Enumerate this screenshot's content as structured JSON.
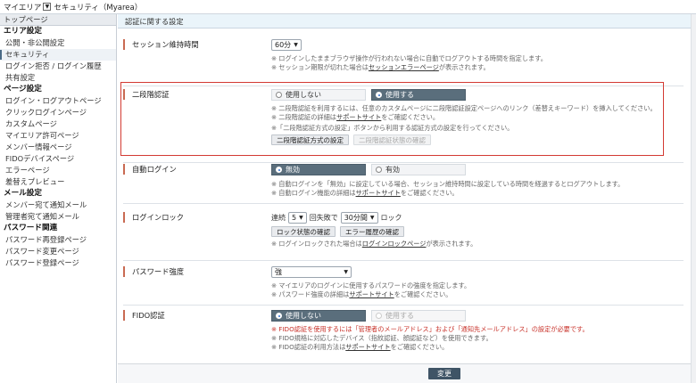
{
  "topbar": {
    "app": "マイエリア",
    "dropdown_glyph": "▼",
    "section": "セキュリティ（Myarea）"
  },
  "sidebar": {
    "top": "トップページ",
    "groups": [
      {
        "heading": "エリア設定",
        "items": [
          "公開・非公開設定",
          "セキュリティ",
          "ログイン拒否 / ログイン履歴",
          "共有設定"
        ]
      },
      {
        "heading": "ページ設定",
        "items": [
          "ログイン・ログアウトページ",
          "クリックログインページ",
          "カスタムページ",
          "マイエリア許可ページ",
          "メンバー情報ページ",
          "FIDOデバイスページ",
          "エラーページ",
          "差替えプレビュー"
        ]
      },
      {
        "heading": "メール設定",
        "items": [
          "メンバー宛て通知メール",
          "管理者宛て通知メール"
        ]
      },
      {
        "heading": "パスワード関連",
        "items": [
          "パスワード再登録ページ",
          "パスワード変更ページ",
          "パスワード登録ページ"
        ]
      }
    ]
  },
  "main": {
    "header": "認証に関する設定",
    "session": {
      "label": "セッション維持時間",
      "value": "60分",
      "note1": "※ ログインしたままブラウザ操作が行われない場合に自動でログアウトする時間を指定します。",
      "note2_pre": "※ セッション期限が切れた場合は",
      "note2_link": "セッションエラーページ",
      "note2_post": "が表示されます。"
    },
    "twofactor": {
      "label": "二段階認証",
      "opt_off": "使用しない",
      "opt_on": "使用する",
      "note1": "※ 二段階認証を利用するには、任意のカスタムページに二段階認証設定ページへのリンク（差替えキーワード）を挿入してください。",
      "note2_pre": "※ 二段階認証の詳細は",
      "note2_link": "サポートサイト",
      "note2_post": "をご確認ください。",
      "note3": "※「二段階認証方式の設定」ボタンから利用する認証方式の設定を行ってください。",
      "btn_settings": "二段階認証方式の設定",
      "btn_status": "二段階認証状態の確認"
    },
    "autologin": {
      "label": "自動ログイン",
      "opt_off": "無効",
      "opt_on": "有効",
      "note1": "※ 自動ログインを「無効」に設定している場合、セッション維持時間に設定している時間を経過するとログアウトします。",
      "note2_pre": "※ 自動ログイン機能の詳細は",
      "note2_link": "サポートサイト",
      "note2_post": "をご確認ください。"
    },
    "lock": {
      "label": "ログインロック",
      "t1": "連続",
      "count": "5",
      "t2": "回失敗で",
      "duration": "30分間",
      "t3": "ロック",
      "btn_status": "ロック状態の確認",
      "btn_history": "エラー履歴の確認",
      "note_pre": "※ ログインロックされた場合は",
      "note_link": "ログインロックページ",
      "note_post": "が表示されます。"
    },
    "password": {
      "label": "パスワード強度",
      "value": "強",
      "note1": "※ マイエリアのログインに使用するパスワードの強度を指定します。",
      "note2_pre": "※ パスワード強度の詳細は",
      "note2_link": "サポートサイト",
      "note2_post": "をご確認ください。"
    },
    "fido": {
      "label": "FIDO認証",
      "opt_off": "使用しない",
      "opt_on": "使用する",
      "note1": "※ FIDO認証を使用するには「管理者のメールアドレス」および「通知先メールアドレス」の設定が必要です。",
      "note2": "※ FIDO規格に対応したデバイス（指紋認証、顔認証など）を使用できます。",
      "note3_pre": "※ FIDO認証の利用方法は",
      "note3_link": "サポートサイト",
      "note3_post": "をご確認ください。"
    }
  },
  "footer": {
    "submit": "変更"
  },
  "colors": {
    "accent": "#5a6e7c",
    "highlight": "#d33a33",
    "section_marker": "#c96a52",
    "submit_bg": "#3f5466"
  }
}
